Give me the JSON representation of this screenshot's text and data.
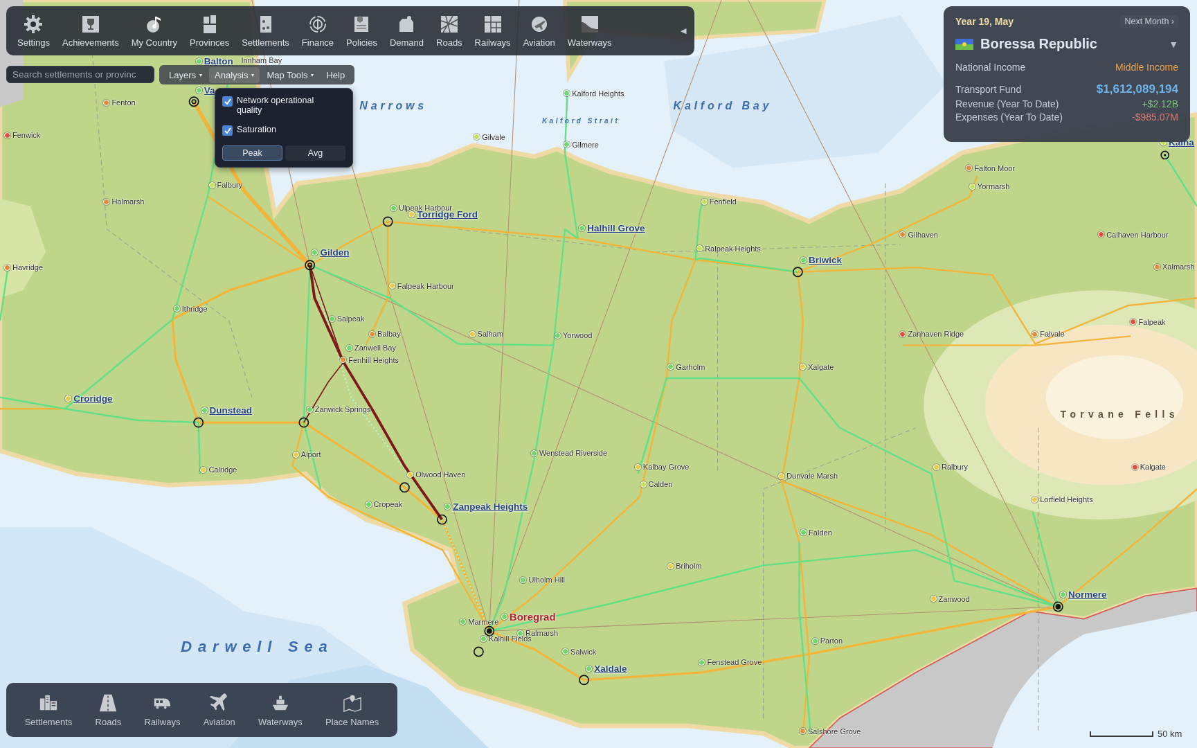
{
  "toolbar": {
    "items": [
      {
        "label": "Settings"
      },
      {
        "label": "Achievements"
      },
      {
        "label": "My Country"
      },
      {
        "label": "Provinces"
      },
      {
        "label": "Settlements"
      },
      {
        "label": "Finance"
      },
      {
        "label": "Policies"
      },
      {
        "label": "Demand"
      },
      {
        "label": "Roads"
      },
      {
        "label": "Railways"
      },
      {
        "label": "Aviation"
      },
      {
        "label": "Waterways"
      }
    ],
    "collapse": "◀"
  },
  "search": {
    "placeholder": "Search settlements or provinc"
  },
  "menu": [
    {
      "label": "Layers",
      "caret": "▾",
      "selected": false
    },
    {
      "label": "Analysis",
      "caret": "▾",
      "selected": true
    },
    {
      "label": "Map Tools",
      "caret": "▾",
      "selected": false
    },
    {
      "label": "Help",
      "selected": false
    }
  ],
  "analysis_menu": {
    "options": [
      {
        "label": "Network operational quality",
        "checked": true
      },
      {
        "label": "Saturation",
        "checked": true
      }
    ],
    "modes": [
      {
        "label": "Peak",
        "selected": true
      },
      {
        "label": "Avg",
        "selected": false
      }
    ]
  },
  "country_panel": {
    "date": "Year 19, May",
    "next_month": "Next Month ›",
    "country": "Boressa Republic",
    "dropdown": "▼",
    "income": {
      "label": "National Income",
      "value": "Middle Income",
      "color": "#e8a24a"
    },
    "finances": [
      {
        "label": "Transport Fund",
        "value": "$1,612,089,194",
        "color": "#6cb4ec"
      },
      {
        "label": "Revenue (Year To Date)",
        "value": "+$2.12B",
        "color": "#7cc47a"
      },
      {
        "label": "Expenses (Year To Date)",
        "value": "-$985.07M",
        "color": "#d97a72"
      }
    ]
  },
  "map": {
    "water_labels": [
      {
        "text": "Narrows",
        "kind": "bay"
      },
      {
        "text": "Kalford Bay",
        "kind": "bay"
      },
      {
        "text": "Kalford Strait",
        "kind": "strait"
      },
      {
        "text": "Darwell Sea",
        "kind": "sea"
      },
      {
        "text": "Torvane Fells",
        "kind": "region"
      }
    ],
    "settlements": [
      {
        "text": "Balton",
        "kind": "city",
        "color": "#6fd66a"
      },
      {
        "text": "Innham Bay",
        "kind": "label"
      },
      {
        "text": "Va",
        "kind": "city",
        "color": "#6fd66a"
      },
      {
        "text": "Fenton",
        "kind": "town",
        "color": "#e08a3c"
      },
      {
        "text": "Fenwick",
        "kind": "town",
        "color": "#e0503c"
      },
      {
        "text": "Falbury",
        "kind": "town",
        "color": "#c4e35a"
      },
      {
        "text": "Halmarsh",
        "kind": "town",
        "color": "#e08a3c"
      },
      {
        "text": "Havridge",
        "kind": "town",
        "color": "#e08a3c"
      },
      {
        "text": "Kalford Heights",
        "kind": "town",
        "color": "#6fd66a"
      },
      {
        "text": "Gilvale",
        "kind": "town",
        "color": "#c4e35a"
      },
      {
        "text": "Gilmere",
        "kind": "town",
        "color": "#6fd66a"
      },
      {
        "text": "Ulpeak Harbour",
        "kind": "town",
        "color": "#6fd66a"
      },
      {
        "text": "Torridge Ford",
        "kind": "city",
        "color": "#e6cc4a"
      },
      {
        "text": "Gilden",
        "kind": "city",
        "color": "#6fd66a"
      },
      {
        "text": "Halhill Grove",
        "kind": "city",
        "color": "#6fd66a"
      },
      {
        "text": "Fenfield",
        "kind": "town",
        "color": "#c4e35a"
      },
      {
        "text": "Falton Moor",
        "kind": "town",
        "color": "#e08a3c"
      },
      {
        "text": "Yormarsh",
        "kind": "town",
        "color": "#c4e35a"
      },
      {
        "text": "Ralpeak Heights",
        "kind": "town",
        "color": "#c4e35a"
      },
      {
        "text": "Briwick",
        "kind": "city",
        "color": "#6fd66a"
      },
      {
        "text": "Gilhaven",
        "kind": "town",
        "color": "#e08a3c"
      },
      {
        "text": "Calhaven Harbour",
        "kind": "town",
        "color": "#e0503c"
      },
      {
        "text": "Xalmarsh",
        "kind": "town",
        "color": "#e08a3c"
      },
      {
        "text": "Kalha",
        "kind": "city",
        "color": "#c4e35a"
      },
      {
        "text": "Falpeak Harbour",
        "kind": "town",
        "color": "#e6cc4a"
      },
      {
        "text": "Ithridge",
        "kind": "town",
        "color": "#6fd66a"
      },
      {
        "text": "Salpeak",
        "kind": "town",
        "color": "#6fd66a"
      },
      {
        "text": "Balbay",
        "kind": "town",
        "color": "#e08a3c"
      },
      {
        "text": "Salham",
        "kind": "town",
        "color": "#e6cc4a"
      },
      {
        "text": "Yorwood",
        "kind": "town",
        "color": "#6fd66a"
      },
      {
        "text": "Zanwell Bay",
        "kind": "town",
        "color": "#6fd66a"
      },
      {
        "text": "Fenhill Heights",
        "kind": "town",
        "color": "#e08a3c"
      },
      {
        "text": "Zanhaven Ridge",
        "kind": "town",
        "color": "#e0503c"
      },
      {
        "text": "Falvale",
        "kind": "town",
        "color": "#e08a3c"
      },
      {
        "text": "Falpeak",
        "kind": "town",
        "color": "#e0503c"
      },
      {
        "text": "Garholm",
        "kind": "town",
        "color": "#6fd66a"
      },
      {
        "text": "Xalgate",
        "kind": "town",
        "color": "#e6cc4a"
      },
      {
        "text": "Croridge",
        "kind": "city",
        "color": "#e6cc4a"
      },
      {
        "text": "Dunstead",
        "kind": "city",
        "color": "#6fd66a"
      },
      {
        "text": "Zanwick Springs",
        "kind": "town",
        "color": "#6fd66a"
      },
      {
        "text": "Alport",
        "kind": "town",
        "color": "#e6cc4a"
      },
      {
        "text": "Wenstead Riverside",
        "kind": "town",
        "color": "#6fd66a"
      },
      {
        "text": "Calridge",
        "kind": "town",
        "color": "#e6cc4a"
      },
      {
        "text": "Kalbay Grove",
        "kind": "town",
        "color": "#e6cc4a"
      },
      {
        "text": "Ralbury",
        "kind": "town",
        "color": "#e6cc4a"
      },
      {
        "text": "Kalgate",
        "kind": "town",
        "color": "#e0503c"
      },
      {
        "text": "Olwood Haven",
        "kind": "town",
        "color": "#e6cc4a"
      },
      {
        "text": "Dunvale Marsh",
        "kind": "town",
        "color": "#e6cc4a"
      },
      {
        "text": "Calden",
        "kind": "town",
        "color": "#c4e35a"
      },
      {
        "text": "Lorfield Heights",
        "kind": "town",
        "color": "#e6cc4a"
      },
      {
        "text": "Cropeak",
        "kind": "town",
        "color": "#6fd66a"
      },
      {
        "text": "Zanpeak Heights",
        "kind": "city",
        "color": "#6fd66a"
      },
      {
        "text": "Falden",
        "kind": "town",
        "color": "#6fd66a"
      },
      {
        "text": "Briholm",
        "kind": "town",
        "color": "#e6cc4a"
      },
      {
        "text": "Ulholm Hill",
        "kind": "town",
        "color": "#6fd66a"
      },
      {
        "text": "Zanwood",
        "kind": "town",
        "color": "#e6cc4a"
      },
      {
        "text": "Normere",
        "kind": "city",
        "color": "#6fd66a"
      },
      {
        "text": "Boregrad",
        "kind": "capital",
        "color": "#6fd66a"
      },
      {
        "text": "Marmere",
        "kind": "town",
        "color": "#6fd66a"
      },
      {
        "text": "Ralmarsh",
        "kind": "town",
        "color": "#6fd66a"
      },
      {
        "text": "Kalhill Fields",
        "kind": "town",
        "color": "#6fd66a"
      },
      {
        "text": "Parton",
        "kind": "town",
        "color": "#6fd66a"
      },
      {
        "text": "Salwick",
        "kind": "town",
        "color": "#6fd66a"
      },
      {
        "text": "Fenstead Grove",
        "kind": "town",
        "color": "#6fd66a"
      },
      {
        "text": "Xaldale",
        "kind": "city",
        "color": "#6fd66a"
      },
      {
        "text": "Salshore Grove",
        "kind": "town",
        "color": "#e08a3c"
      }
    ],
    "scale": "50 km"
  },
  "layers_bar": {
    "items": [
      {
        "label": "Settlements"
      },
      {
        "label": "Roads"
      },
      {
        "label": "Railways"
      },
      {
        "label": "Aviation"
      },
      {
        "label": "Waterways"
      },
      {
        "label": "Place Names"
      }
    ]
  }
}
